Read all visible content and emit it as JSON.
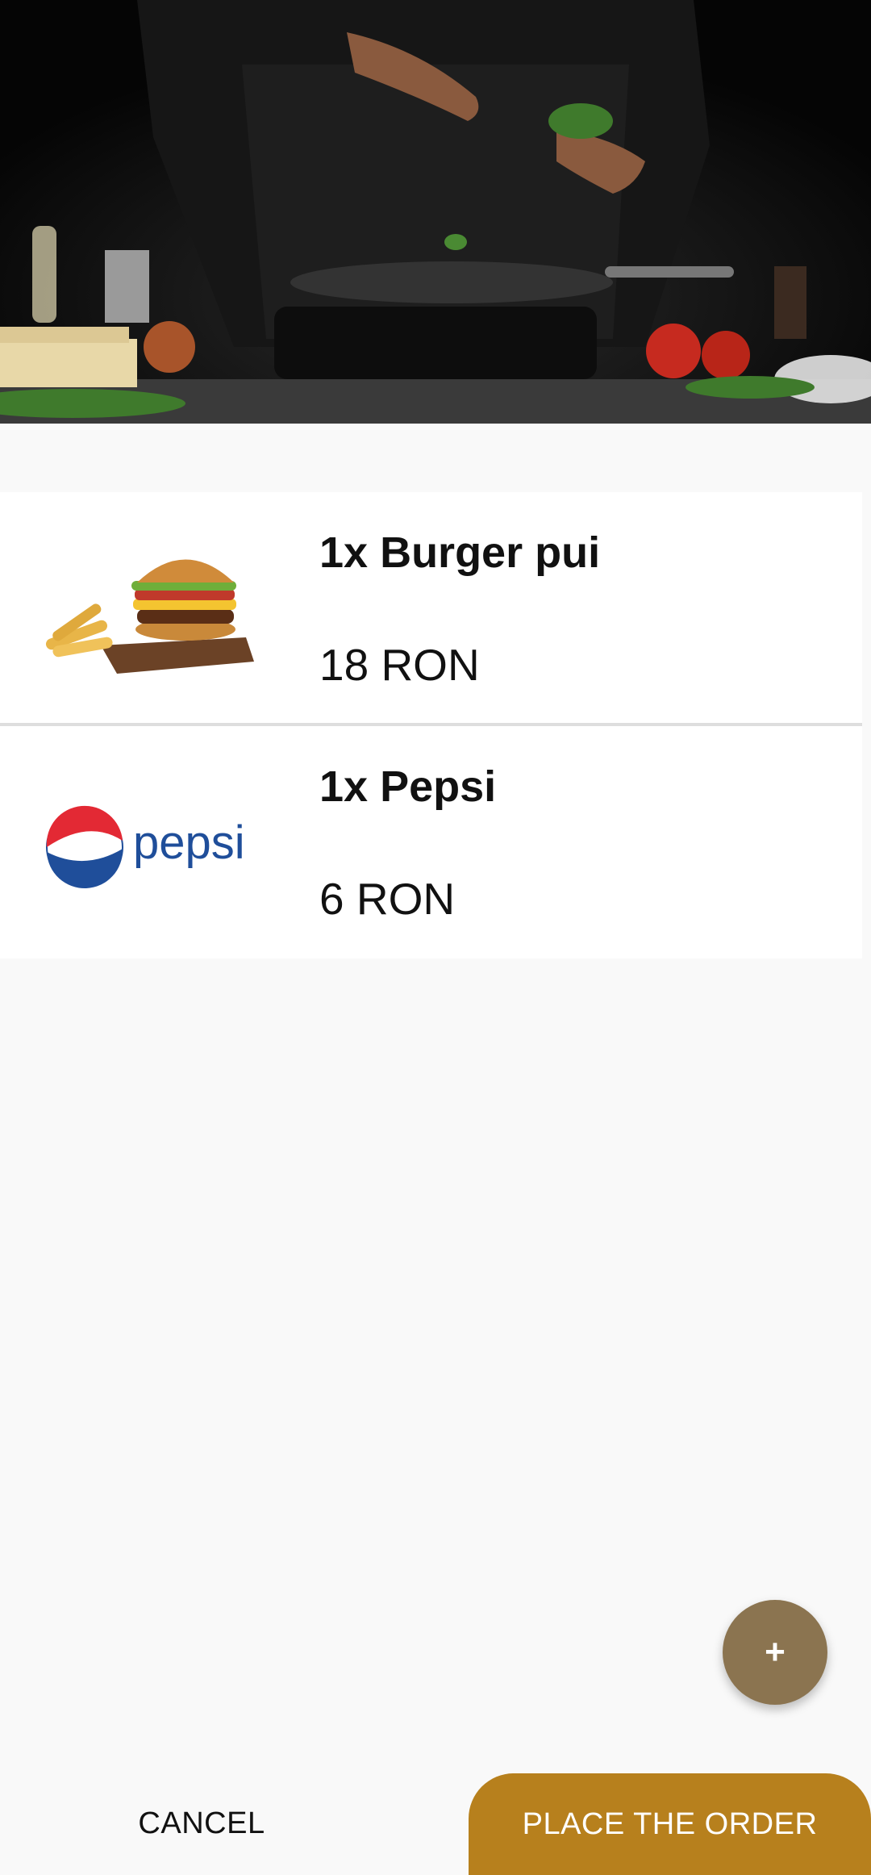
{
  "header": {
    "image": "chef-cooking-photo"
  },
  "order_items": [
    {
      "name": "1x Burger pui",
      "price": "18 RON",
      "image": "burger-with-fries-photo"
    },
    {
      "name": "1x Pepsi",
      "price": "6 RON",
      "image": "pepsi-logo",
      "logo_text": "pepsi"
    }
  ],
  "fab": {
    "icon": "plus-icon",
    "symbol": "+"
  },
  "actions": {
    "cancel_label": "CANCEL",
    "order_label": "PLACE THE ORDER"
  },
  "colors": {
    "accent": "#b7801d",
    "fab": "#8b7450",
    "background": "#f9f9f9"
  }
}
